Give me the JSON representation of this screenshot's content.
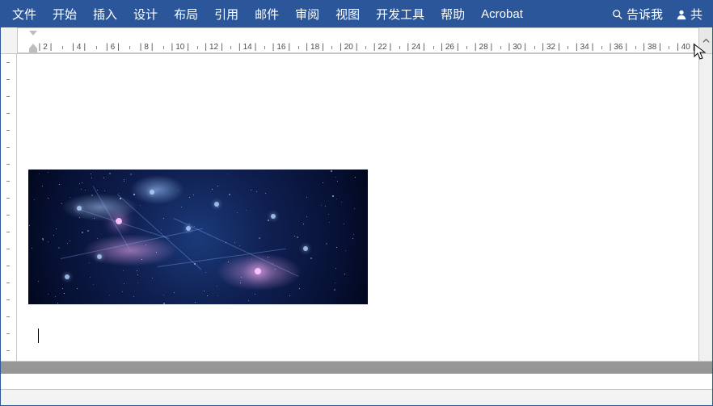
{
  "ribbon": {
    "tabs": [
      "文件",
      "开始",
      "插入",
      "设计",
      "布局",
      "引用",
      "邮件",
      "审阅",
      "视图",
      "开发工具",
      "帮助",
      "Acrobat"
    ],
    "tellme_label": "告诉我",
    "share_label": "共"
  },
  "ruler": {
    "numbers": [
      2,
      4,
      6,
      8,
      10,
      12,
      14,
      16,
      18,
      20,
      22,
      24,
      26,
      28,
      30,
      32,
      34,
      36,
      38,
      40
    ]
  },
  "document": {
    "image_alt": "starfield-network-graphic"
  }
}
